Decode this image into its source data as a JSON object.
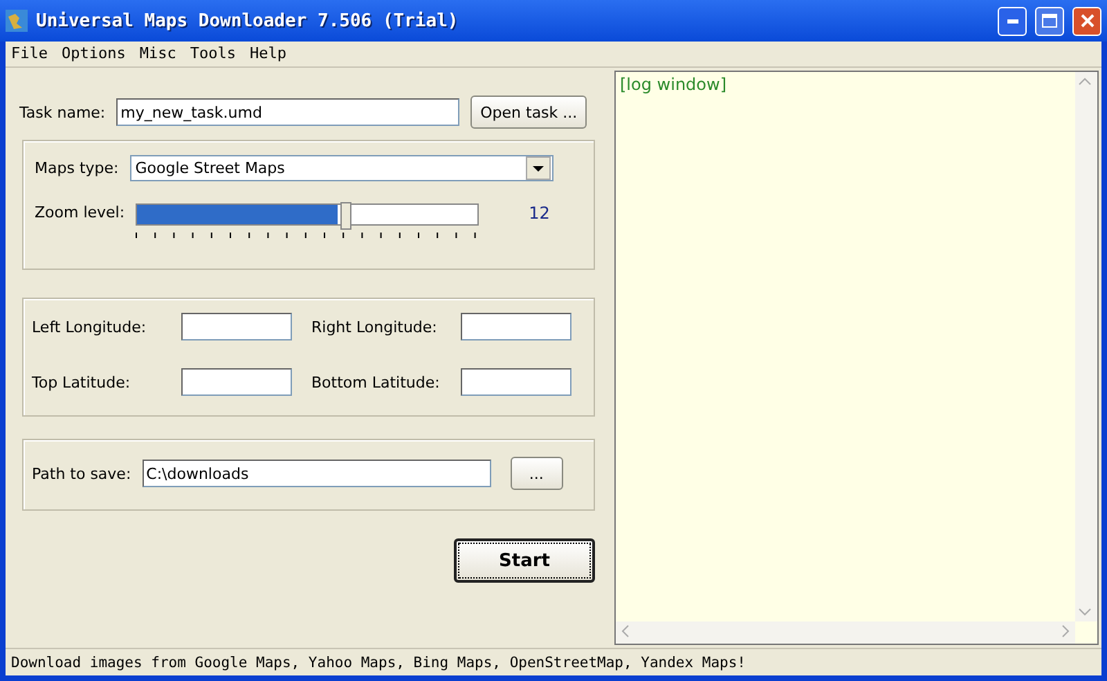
{
  "window": {
    "title": "Universal Maps Downloader 7.506 (Trial)"
  },
  "menu": [
    "File",
    "Options",
    "Misc",
    "Tools",
    "Help"
  ],
  "task": {
    "label": "Task name:",
    "value": "my_new_task.umd",
    "button": "Open task ..."
  },
  "maps_type": {
    "label": "Maps type:",
    "value": "Google Street Maps"
  },
  "zoom": {
    "label": "Zoom level:",
    "level": 0.59,
    "reading": "12"
  },
  "coords": [
    {
      "label": "Left Longitude:"
    },
    {
      "label": "Right Longitude:"
    },
    {
      "label": "Top Latitude:"
    },
    {
      "label": "Bottom Latitude:"
    }
  ],
  "path": {
    "label": "Path to save:",
    "value": "C:\\downloads",
    "button": "..."
  },
  "start_button": "Start",
  "log": {
    "text": "[log window]"
  },
  "status_bar": "Download images from Google Maps, Yahoo Maps, Bing Maps, OpenStreetMap, Yandex Maps!"
}
